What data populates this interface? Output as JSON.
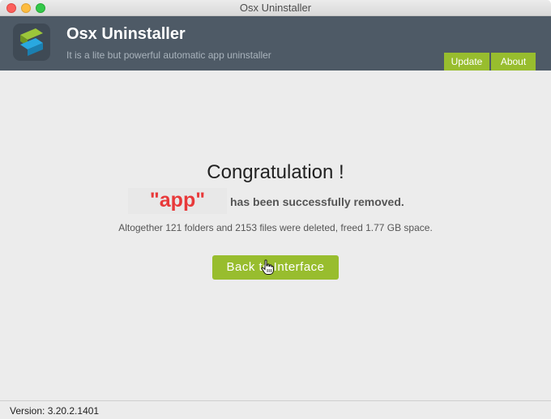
{
  "window": {
    "title": "Osx Uninstaller"
  },
  "header": {
    "app_name": "Osx Uninstaller",
    "tagline": "It is a lite but powerful automatic app uninstaller",
    "tabs": [
      {
        "label": "Update"
      },
      {
        "label": "About"
      }
    ],
    "logo_icon": "osx-uninstaller-logo-icon"
  },
  "main": {
    "heading": "Congratulation !",
    "app_name_quoted": "\"app\"",
    "removed_message": "has been successfully removed.",
    "summary": "Altogether 121 folders and 2153 files were deleted, freed 1.77 GB space.",
    "back_button_label": "Back to Interface"
  },
  "status": {
    "version": "Version: 3.20.2.1401"
  },
  "colors": {
    "accent": "#98bd2e",
    "header_bg": "#4e5a66",
    "app_name_red": "#e8393a"
  }
}
